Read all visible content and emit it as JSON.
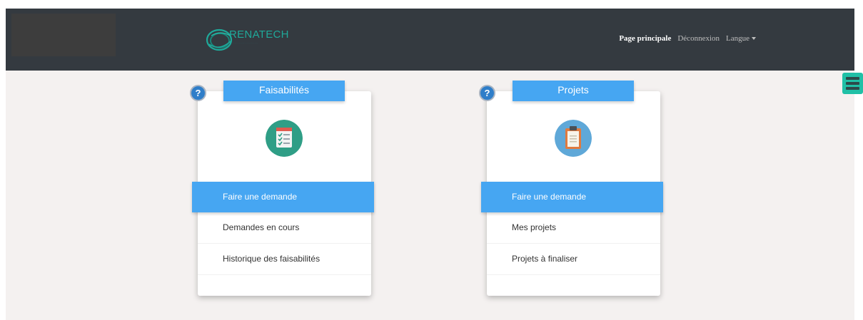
{
  "nav": {
    "logo_text": "RENATECH",
    "links": [
      "Page principale",
      "Déconnexion",
      "Langue"
    ]
  },
  "cards": [
    {
      "title": "Faisabilités",
      "help": "?",
      "icon": "checklist-icon",
      "items": [
        "Faire une demande",
        "Demandes en cours",
        "Historique des faisabilités"
      ]
    },
    {
      "title": "Projets",
      "help": "?",
      "icon": "clipboard-icon",
      "items": [
        "Faire une demande",
        "Mes projets",
        "Projets à finaliser"
      ]
    }
  ],
  "menu_icon": "hamburger-menu-icon",
  "colors": {
    "navbar": "#343a40",
    "accent": "#46a6f2",
    "background": "#f4f1f0",
    "menu_button": "#20c0a6"
  }
}
